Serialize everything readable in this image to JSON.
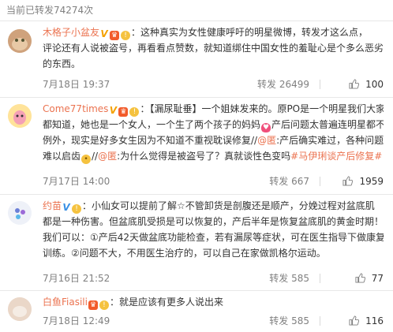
{
  "header": {
    "text": "当前已转发74274次"
  },
  "posts": [
    {
      "user": "木格子小盆友",
      "text_lines": [
        "：这种真实为女性健康呼吁的明星微博，转发才这么点，",
        "评论还有人说被盗号，再看看点赞数，就知道绑住中国女性的羞耻心是个多么恶劣",
        "的东西。"
      ],
      "time": "7月18日 19:37",
      "forward_label": "转发 26499",
      "likes": "100"
    },
    {
      "user": "Come77times",
      "text_lines": [
        "：【漏尿耻垂】一个姐妹发来的。原PO是一个明星我们大家",
        "都知道，她也是一个女人，一个生了两个孩子的妈妈",
        "产后问题太普遍连明星都不",
        "例外，现实是好多女生因为不知道不重视耽误修复//",
        "@匿",
        ":产后确实难过，各种问题",
        "难以启齿",
        "//",
        "@匿",
        ":为什么觉得是被盗号了？真就谈性色变吗",
        "#马伊琍谈产后修复#"
      ],
      "time": "7月17日 14:00",
      "forward_label": "转发 667",
      "likes": "1959"
    },
    {
      "user": "约苗",
      "text_lines": [
        "：小仙女可以提前了解☆不管卸货是剖腹还是顺产，分娩过程对盆底肌",
        "都是一种伤害。但盆底肌受损是可以恢复的，产后半年是恢复盆底肌的黄金时期！",
        "我们可以：",
        "①",
        "产后42天做盆底功能检查，若有漏尿等症状，可在医生指导下做康复",
        "训练。",
        "②",
        "问题不大，不用医生治疗的，可以自己在家做凯格尔运动。"
      ],
      "time": "7月16日 21:52",
      "forward_label": "转发 585",
      "likes": "77"
    },
    {
      "user": "白鱼Fiasili",
      "text_lines": [
        "：就是应该有更多人说出来"
      ],
      "time": "7月18日 12:49",
      "forward_label": "转发 585",
      "likes": "116"
    }
  ],
  "icons": {
    "v_badge": "V",
    "vip_badge": "vip-icon",
    "bulb_badge": "bulb-icon",
    "heart": "heart-emoji-icon",
    "smile": "smile-emoji-icon",
    "thumb": "thumbs-up-icon"
  },
  "colors": {
    "link": "#eb7350",
    "meta": "#808080",
    "text": "#333333"
  }
}
